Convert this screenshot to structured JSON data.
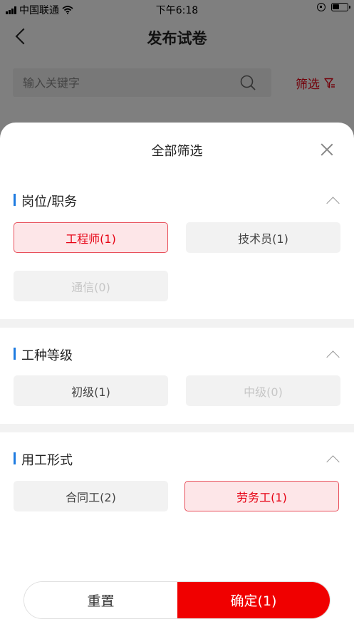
{
  "status_bar": {
    "carrier": "中国联通",
    "time": "下午6:18"
  },
  "nav": {
    "title": "发布试卷"
  },
  "search": {
    "placeholder": "输入关键字",
    "value": ""
  },
  "filter": {
    "label": "筛选"
  },
  "sheet": {
    "title": "全部筛选",
    "sections": [
      {
        "title": "岗位/职务",
        "options": [
          {
            "label": "工程师(1)",
            "state": "selected"
          },
          {
            "label": "技术员(1)",
            "state": "normal"
          },
          {
            "label": "通信(0)",
            "state": "disabled"
          }
        ]
      },
      {
        "title": "工种等级",
        "options": [
          {
            "label": "初级(1)",
            "state": "normal"
          },
          {
            "label": "中级(0)",
            "state": "disabled"
          }
        ]
      },
      {
        "title": "用工形式",
        "options": [
          {
            "label": "合同工(2)",
            "state": "normal"
          },
          {
            "label": "劳务工(1)",
            "state": "selected"
          }
        ]
      }
    ],
    "reset_label": "重置",
    "confirm_label": "确定(1)"
  },
  "colors": {
    "accent_red": "#e60012",
    "confirm_red": "#f00000",
    "section_bar_blue": "#1e7be0",
    "selected_bg": "#fde6e8"
  }
}
